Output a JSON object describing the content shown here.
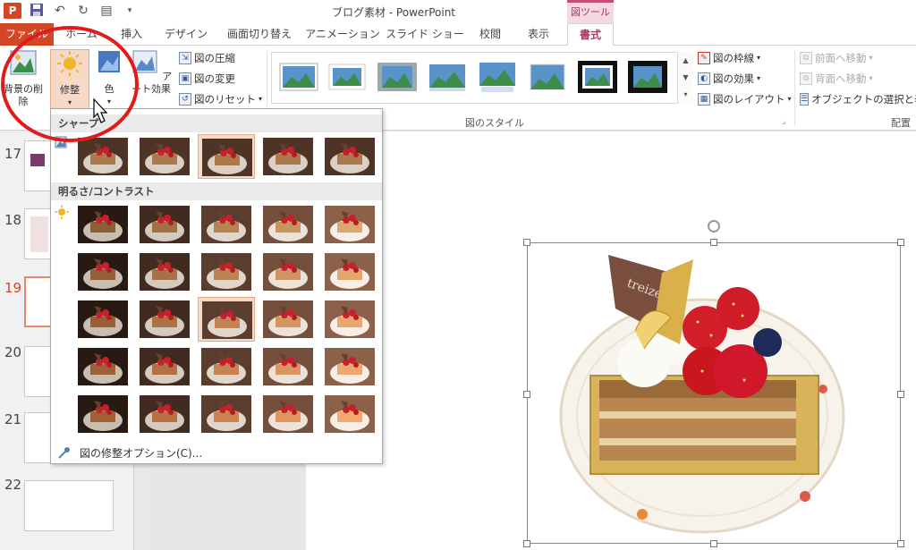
{
  "window": {
    "title": "ブログ素材 - PowerPoint",
    "app_logo": "P",
    "context_tool": "図ツール"
  },
  "tabs": [
    "ファイル",
    "ホーム",
    "挿入",
    "デザイン",
    "画面切り替え",
    "アニメーション",
    "スライド ショー",
    "校閲",
    "表示",
    "書式"
  ],
  "active_tab": "書式",
  "ribbon": {
    "remove_bg": "背景の削除",
    "corrections": "修整",
    "color": "色",
    "art_effects": "アート効果",
    "compress": "図の圧縮",
    "change_pic": "図の変更",
    "reset_pic": "図のリセット",
    "styles_group": "図のスタイル",
    "border": "図の枠線",
    "effects": "図の効果",
    "layout": "図のレイアウト",
    "bring_forward": "前面へ移動",
    "send_backward": "背面へ移動",
    "selection_pane": "オブジェクトの選択と表示",
    "arrange_group": "配置"
  },
  "dropdown": {
    "sharpen_header": "シャープ",
    "brightness_header": "明るさ/コントラスト",
    "options_link": "図の修整オプション(C)...",
    "selected_sharpen_index": 2,
    "selected_brightness": [
      2,
      2
    ]
  },
  "slides": {
    "numbers": [
      "17",
      "18",
      "19",
      "20",
      "21",
      "22"
    ],
    "current": "19"
  },
  "colors": {
    "accent": "#d24726",
    "tool_context": "#b0345a",
    "annotation": "#e01b1b"
  }
}
